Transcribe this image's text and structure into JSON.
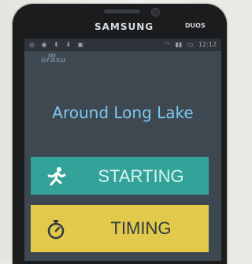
{
  "device": {
    "brand": "SAMSUNG",
    "model_badge": "DUOS"
  },
  "statusbar": {
    "time": "12:12"
  },
  "app": {
    "logo_text": "orasu",
    "title": "Around Long Lake"
  },
  "buttons": [
    {
      "label": "STARTING",
      "icon": "runner-icon",
      "color": "#33a39a"
    },
    {
      "label": "TIMING",
      "icon": "stopwatch-icon",
      "color": "#e2c94b"
    }
  ]
}
